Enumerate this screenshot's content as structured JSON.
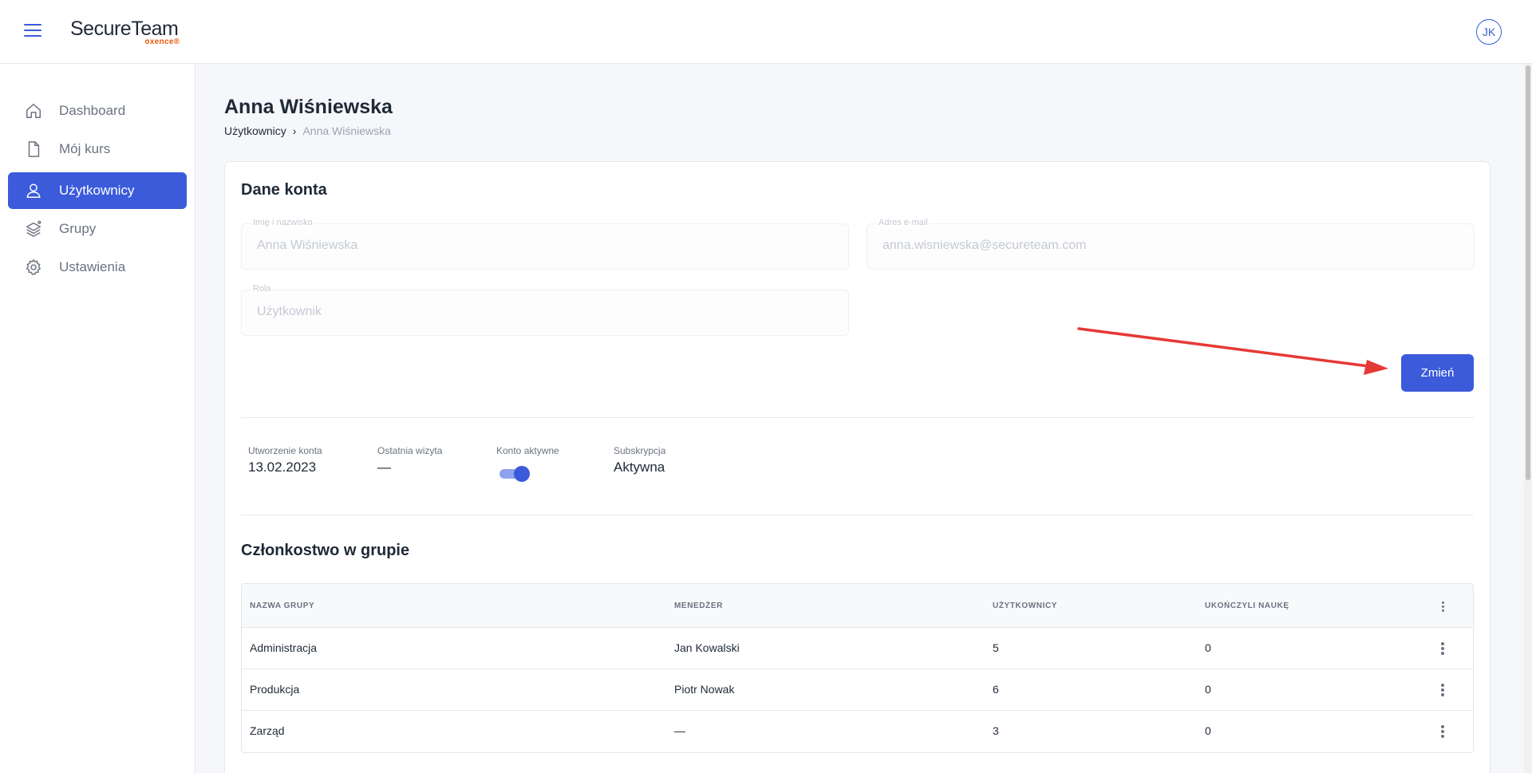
{
  "app": {
    "logo_main": "SecureTeam",
    "logo_sub": "oxence®",
    "avatar_initials": "JK"
  },
  "sidebar": {
    "items": [
      {
        "label": "Dashboard",
        "icon": "home-icon",
        "active": false
      },
      {
        "label": "Mój kurs",
        "icon": "file-icon",
        "active": false
      },
      {
        "label": "Użytkownicy",
        "icon": "user-icon",
        "active": true
      },
      {
        "label": "Grupy",
        "icon": "layers-icon",
        "active": false
      },
      {
        "label": "Ustawienia",
        "icon": "gear-icon",
        "active": false
      }
    ]
  },
  "page": {
    "title": "Anna Wiśniewska",
    "breadcrumb": {
      "parent": "Użytkownicy",
      "current": "Anna Wiśniewska"
    }
  },
  "account": {
    "section_title": "Dane konta",
    "name_label": "Imię i nazwisko",
    "name_value": "Anna Wiśniewska",
    "email_label": "Adres e-mail",
    "email_value": "anna.wisniewska@secureteam.com",
    "role_label": "Rola",
    "role_value": "Użytkownik",
    "change_button": "Zmień"
  },
  "stats": {
    "created_label": "Utworzenie konta",
    "created_value": "13.02.2023",
    "last_visit_label": "Ostatnia wizyta",
    "last_visit_value": "—",
    "active_label": "Konto aktywne",
    "active_value": true,
    "subscription_label": "Subskrypcja",
    "subscription_value": "Aktywna"
  },
  "groups": {
    "section_title": "Członkostwo w grupie",
    "columns": [
      "Nazwa grupy",
      "Menedżer",
      "Użytkownicy",
      "Ukończyli naukę"
    ],
    "rows": [
      {
        "name": "Administracja",
        "manager": "Jan Kowalski",
        "users": "5",
        "completed": "0"
      },
      {
        "name": "Produkcja",
        "manager": "Piotr Nowak",
        "users": "6",
        "completed": "0"
      },
      {
        "name": "Zarząd",
        "manager": "—",
        "users": "3",
        "completed": "0"
      }
    ]
  },
  "colors": {
    "accent": "#3b5bdb",
    "annotation_arrow": "#e53935"
  }
}
